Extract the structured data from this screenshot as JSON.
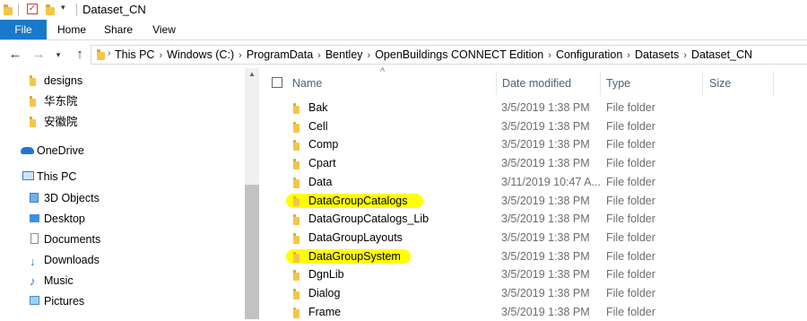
{
  "window": {
    "title": "Dataset_CN"
  },
  "ribbon": {
    "tabs": [
      "File",
      "Home",
      "Share",
      "View"
    ]
  },
  "address": {
    "crumbs": [
      "This PC",
      "Windows (C:)",
      "ProgramData",
      "Bentley",
      "OpenBuildings CONNECT Edition",
      "Configuration",
      "Datasets",
      "Dataset_CN"
    ]
  },
  "navpane": {
    "items": [
      {
        "label": "designs",
        "icon": "folder-icon"
      },
      {
        "label": "华东院",
        "icon": "folder-icon"
      },
      {
        "label": "安徽院",
        "icon": "folder-icon"
      },
      {
        "label": "OneDrive",
        "icon": "onedrive-icon"
      },
      {
        "label": "This PC",
        "icon": "pc-icon"
      },
      {
        "label": "3D Objects",
        "icon": "3d-objects-icon"
      },
      {
        "label": "Desktop",
        "icon": "desktop-icon"
      },
      {
        "label": "Documents",
        "icon": "documents-icon"
      },
      {
        "label": "Downloads",
        "icon": "downloads-icon"
      },
      {
        "label": "Music",
        "icon": "music-icon"
      },
      {
        "label": "Pictures",
        "icon": "pictures-icon"
      }
    ]
  },
  "columns": {
    "name": "Name",
    "date": "Date modified",
    "type": "Type",
    "size": "Size"
  },
  "files": [
    {
      "name": "Bak",
      "date": "3/5/2019 1:38 PM",
      "type": "File folder",
      "highlighted": false
    },
    {
      "name": "Cell",
      "date": "3/5/2019 1:38 PM",
      "type": "File folder",
      "highlighted": false
    },
    {
      "name": "Comp",
      "date": "3/5/2019 1:38 PM",
      "type": "File folder",
      "highlighted": false
    },
    {
      "name": "Cpart",
      "date": "3/5/2019 1:38 PM",
      "type": "File folder",
      "highlighted": false
    },
    {
      "name": "Data",
      "date": "3/11/2019 10:47 A...",
      "type": "File folder",
      "highlighted": false
    },
    {
      "name": "DataGroupCatalogs",
      "date": "3/5/2019 1:38 PM",
      "type": "File folder",
      "highlighted": true
    },
    {
      "name": "DataGroupCatalogs_Lib",
      "date": "3/5/2019 1:38 PM",
      "type": "File folder",
      "highlighted": false
    },
    {
      "name": "DataGroupLayouts",
      "date": "3/5/2019 1:38 PM",
      "type": "File folder",
      "highlighted": false
    },
    {
      "name": "DataGroupSystem",
      "date": "3/5/2019 1:38 PM",
      "type": "File folder",
      "highlighted": true
    },
    {
      "name": "DgnLib",
      "date": "3/5/2019 1:38 PM",
      "type": "File folder",
      "highlighted": false
    },
    {
      "name": "Dialog",
      "date": "3/5/2019 1:38 PM",
      "type": "File folder",
      "highlighted": false
    },
    {
      "name": "Frame",
      "date": "3/5/2019 1:38 PM",
      "type": "File folder",
      "highlighted": false
    }
  ],
  "colors": {
    "file_tab": "#1979ca",
    "folder": "#f3c649",
    "highlight": "#ffff00",
    "header_text": "#4c607a"
  }
}
